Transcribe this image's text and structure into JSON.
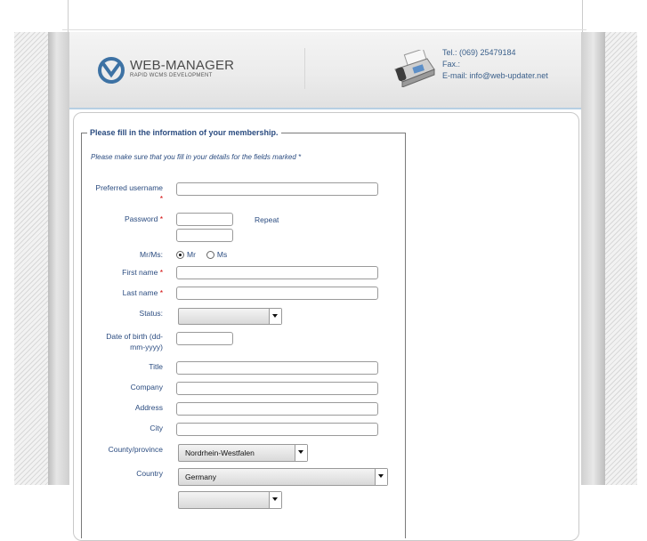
{
  "header": {
    "logo_title": "WEB-MANAGER",
    "logo_subtitle": "RAPID WCMS DEVELOPMENT",
    "contact": {
      "tel": "Tel.: (069) 25479184",
      "fax": "Fax.:",
      "email": "E-mail: info@web-updater.net"
    }
  },
  "form": {
    "legend": "Please fill in the information of your membership.",
    "note": "Please make sure that you fill in your details for the fields marked *",
    "required_mark": "*",
    "labels": {
      "username": "Preferred username",
      "password": "Password",
      "repeat": "Repeat",
      "salutation": "Mr/Ms:",
      "first_name": "First name",
      "last_name": "Last name",
      "status": "Status:",
      "dob_line1": "Date of birth (dd-",
      "dob_line2": "mm-yyyy)",
      "title": "Title",
      "company": "Company",
      "address": "Address",
      "city": "City",
      "county": "County/province",
      "country": "Country"
    },
    "salutation_options": {
      "mr": "Mr",
      "ms": "Ms",
      "selected": "Mr"
    },
    "values": {
      "username": "",
      "password": "",
      "password_repeat": "",
      "first_name": "",
      "last_name": "",
      "status": "",
      "dob": "",
      "title": "",
      "company": "",
      "address": "",
      "city": "",
      "county": "Nordrhein-Westfalen",
      "country": "Germany"
    }
  },
  "icons": {
    "logo": "web-manager-logo-icon",
    "fax": "fax-machine-icon",
    "dropdown": "chevron-down-icon"
  },
  "colors": {
    "label_blue": "#2b4c80",
    "required_red": "#d10000",
    "header_rule": "#b6cfe3"
  }
}
